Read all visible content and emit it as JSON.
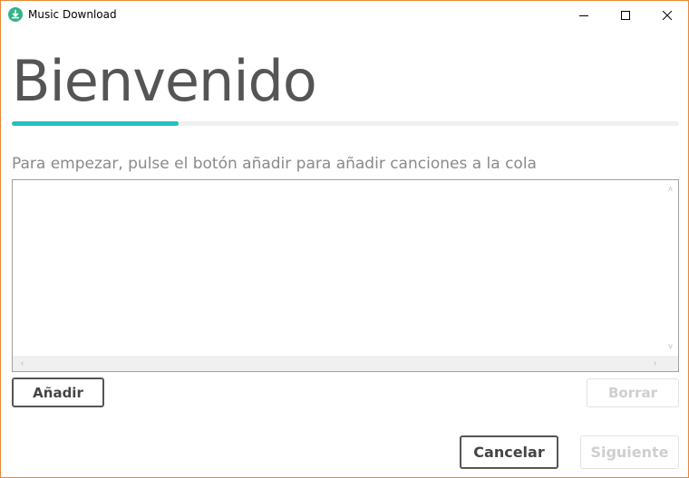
{
  "window": {
    "title": "Music Download",
    "app_icon": "download-icon",
    "controls": [
      "minimize-icon",
      "maximize-icon",
      "close-icon"
    ]
  },
  "wizard": {
    "heading": "Bienvenido",
    "progress_fraction": 0.25,
    "accent_color": "#22c2bd",
    "instructions": "Para empezar, pulse el botón añadir para añadir canciones a la cola"
  },
  "queue": {
    "items": []
  },
  "buttons": {
    "add": "Añadir",
    "delete": "Borrar",
    "cancel": "Cancelar",
    "next": "Siguiente"
  }
}
